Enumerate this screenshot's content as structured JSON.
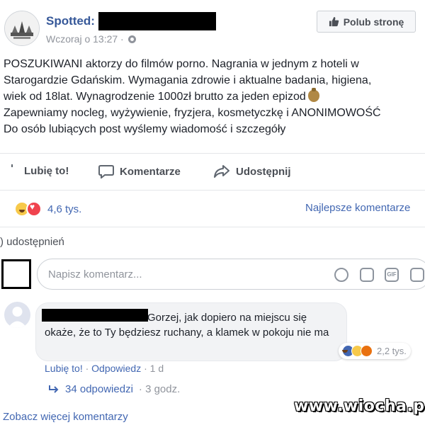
{
  "header": {
    "page_name": "Spotted:",
    "timestamp": "Wczoraj o 13:27 ·",
    "like_page_button": "Polub stronę"
  },
  "post": {
    "lines": [
      "POSZUKIWANI aktorzy do filmów porno. Nagrania w jednym z hoteli w",
      "Starogardzie Gdańskim. Wymagania zdrowie i aktualne badania, higiena,",
      "wiek od 18lat. Wynagrodzenie 1000zł brutto za jeden epizod",
      "Zapewniamy nocleg, wyżywienie, fryzjera, kosmetyczkę i ANONIMOWOŚĆ",
      "Do osób lubiących post wyślemy wiadomość i szczegóły"
    ]
  },
  "actions": {
    "like": "Lubię to!",
    "comment": "Komentarze",
    "share": "Udostępnij"
  },
  "reactions": {
    "count": "4,6 tys.",
    "best_comments": "Najlepsze komentarze",
    "shares": ") udostępnień"
  },
  "composer": {
    "placeholder": "Napisz komentarz..."
  },
  "comment": {
    "text_line1": "Gorzej, jak dopiero na miejscu się",
    "text_rest": "okaże, że to Ty będziesz ruchany, a klamek w pokoju nie ma",
    "reaction_count": "2,2 tys.",
    "like_link": "Lubię to!",
    "separator": " · ",
    "reply_link": "Odpowiedz",
    "age": " · 1 d",
    "replies_link": "34 odpowiedzi",
    "replies_age": "· 3 godz."
  },
  "footer": {
    "more_comments": "Zobacz więcej komentarzy",
    "watermark": "www.wiocha.pl"
  },
  "colors": {
    "link": "#4267b2",
    "page_name": "#365899",
    "muted": "#90949c"
  }
}
